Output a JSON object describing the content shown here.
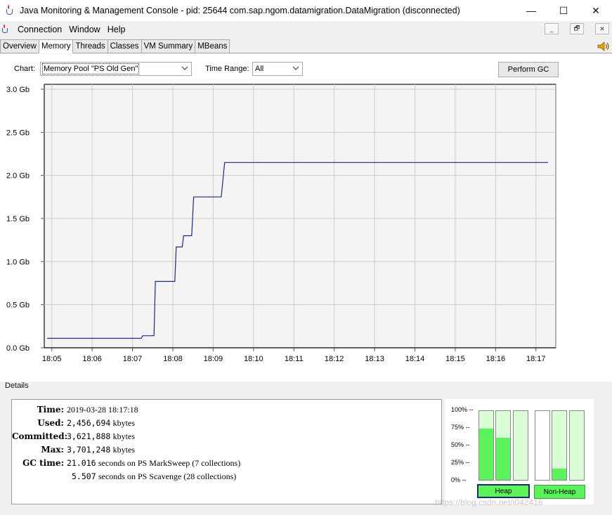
{
  "window": {
    "title": "Java Monitoring & Management Console - pid: 25644 com.sap.ngom.datamigration.DataMigration (disconnected)",
    "minimize": "—",
    "maximize": "☐",
    "close": "✕"
  },
  "menu": {
    "items": [
      "Connection",
      "Window",
      "Help"
    ],
    "mdi": [
      "_",
      "🗗",
      "✕"
    ]
  },
  "tabs": [
    "Overview",
    "Memory",
    "Threads",
    "Classes",
    "VM Summary",
    "MBeans"
  ],
  "active_tab": "Memory",
  "toolbar": {
    "chart_label": "Chart:",
    "chart_value": "Memory Pool \"PS Old Gen\"",
    "time_range_label": "Time Range:",
    "time_range_value": "All",
    "perform_gc": "Perform GC"
  },
  "colors": {
    "line": "#1c2b7a",
    "grid": "#cccccc",
    "heap_fill": "#5bf25b",
    "heap_bg": "#dcfcd7"
  },
  "chart_data": {
    "type": "line",
    "y_ticks": [
      "0.0 Gb",
      "0.5 Gb",
      "1.0 Gb",
      "1.5 Gb",
      "2.0 Gb",
      "2.5 Gb",
      "3.0 Gb"
    ],
    "x_ticks": [
      "18:05",
      "18:06",
      "18:07",
      "18:08",
      "18:09",
      "18:10",
      "18:11",
      "18:12",
      "18:13",
      "18:14",
      "18:15",
      "18:16",
      "18:17"
    ],
    "ylim": [
      0,
      3.0
    ],
    "xlim": [
      "18:04:53",
      "18:17:18"
    ],
    "grid": true,
    "series": [
      {
        "points": [
          [
            "18:04:53",
            0.11
          ],
          [
            "18:07:13",
            0.11
          ],
          [
            "18:07:15",
            0.14
          ],
          [
            "18:07:32",
            0.14
          ],
          [
            "18:07:34",
            0.77
          ],
          [
            "18:08:03",
            0.77
          ],
          [
            "18:08:05",
            1.17
          ],
          [
            "18:08:14",
            1.17
          ],
          [
            "18:08:16",
            1.3
          ],
          [
            "18:08:28",
            1.3
          ],
          [
            "18:08:31",
            1.75
          ],
          [
            "18:09:12",
            1.75
          ],
          [
            "18:09:17",
            2.15
          ],
          [
            "18:17:18",
            2.15
          ]
        ]
      }
    ]
  },
  "details": {
    "title": "Details",
    "time_label": "Time:",
    "time_value": "2019-03-28 18:17:18",
    "used_label": "Used:",
    "used_value": "2,456,694",
    "used_unit": "kbytes",
    "committed_label": "Committed:",
    "committed_value": "3,621,888",
    "committed_unit": "kbytes",
    "max_label": "Max:",
    "max_value": "3,701,248",
    "max_unit": "kbytes",
    "gc_label": "GC time:",
    "gc1_value": "21.016",
    "gc1_text": "seconds on PS MarkSweep (7 collections)",
    "gc2_value": "5.507",
    "gc2_text": "seconds on PS Scavenge (28 collections)"
  },
  "pools": {
    "pct_labels": [
      "100%",
      "75%",
      "50%",
      "25%",
      "0%"
    ],
    "heap_label": "Heap",
    "nonheap_label": "Non-Heap",
    "heap_fills": [
      0.75,
      0.61,
      0.0
    ],
    "heap_committed": [
      1.0,
      1.0,
      1.0
    ],
    "nonheap_fills": [
      0.0,
      0.16,
      0.0
    ],
    "nonheap_committed": [
      0.0,
      1.0,
      1.0
    ]
  },
  "watermark": "https://blog.csdn.net/i042416"
}
